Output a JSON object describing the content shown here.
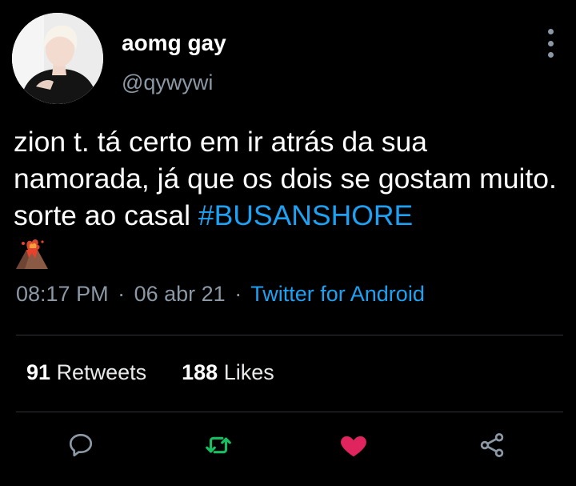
{
  "user": {
    "display_name": "aomg gay",
    "handle": "@qywywi"
  },
  "tweet": {
    "text": "zion t. tá certo em ir atrás da sua namorada, já que os dois se gostam muito. sorte ao casal ",
    "hashtag": "#BUSANSHORE",
    "emoji": "volcano-emoji"
  },
  "meta": {
    "time": "08:17 PM",
    "separator": "·",
    "date": "06 abr 21",
    "source": "Twitter for Android"
  },
  "stats": {
    "retweets_count": "91",
    "retweets_label": "Retweets",
    "likes_count": "188",
    "likes_label": "Likes"
  },
  "colors": {
    "background": "#000000",
    "text": "#ffffff",
    "secondary_text": "#8b98a5",
    "link": "#1da1f2",
    "divider": "#2f3336",
    "reply_icon": "#8b98a5",
    "retweet_icon": "#17bf63",
    "like_icon": "#e0245e",
    "share_icon": "#8b98a5"
  },
  "icons": {
    "more": "more-vertical-icon",
    "reply": "reply-icon",
    "retweet": "retweet-icon",
    "like": "heart-icon",
    "share": "share-icon"
  }
}
